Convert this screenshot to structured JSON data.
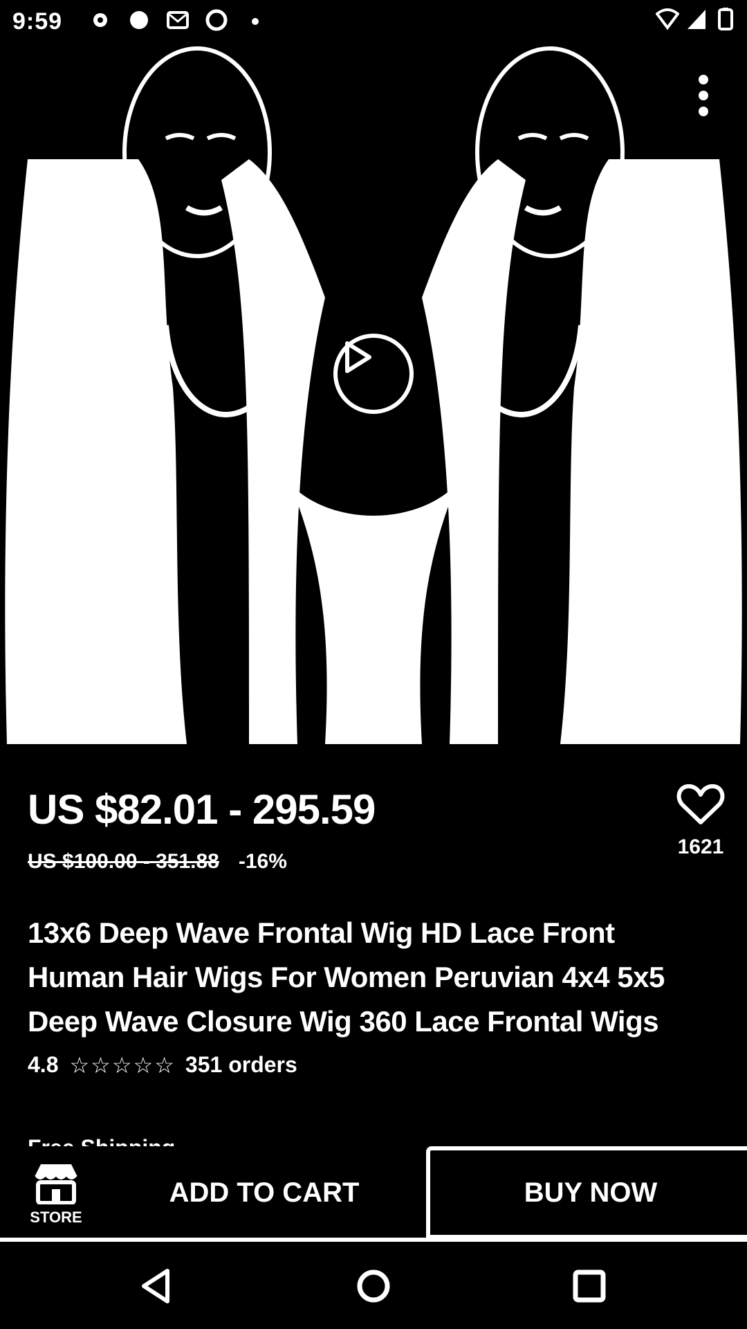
{
  "status_bar": {
    "time": "9:59",
    "icons": [
      "settings-icon",
      "app-icon",
      "mail-icon",
      "app-icon",
      "dot-icon"
    ],
    "right_icons": [
      "wifi-icon",
      "signal-icon",
      "battery-icon"
    ]
  },
  "hero": {
    "image": "product-photo-two-models-deep-wave-wigs",
    "play_icon": "play-icon",
    "more_icon": "more-vertical-icon"
  },
  "product": {
    "price": "US $82.01 - 295.59",
    "original_price": "US $100.00 - 351.88",
    "discount": "-16%",
    "wishlist_count": "1621",
    "title": "13x6 Deep Wave Frontal Wig HD Lace Front Human Hair Wigs For Women Peruvian 4x4 5x5 Deep Wave Closure Wig 360 Lace Frontal Wigs",
    "rating": "4.8",
    "stars": 5,
    "orders": "351 orders",
    "shipping": "Free Shipping"
  },
  "action_bar": {
    "store_label": "STORE",
    "add_to_cart": "ADD TO CART",
    "buy_now": "BUY NOW"
  },
  "nav_bar": {
    "icons": [
      "back-icon",
      "home-icon",
      "recents-icon"
    ]
  }
}
